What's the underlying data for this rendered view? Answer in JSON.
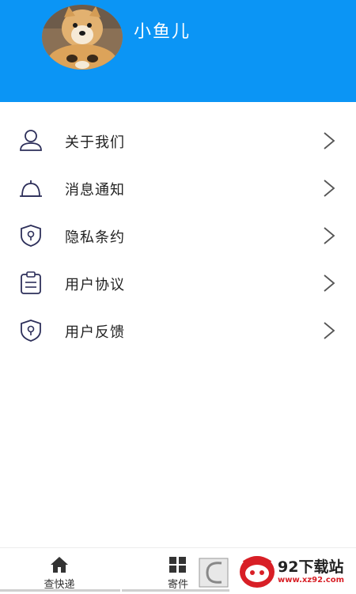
{
  "header": {
    "username": "小鱼儿"
  },
  "menu": {
    "items": [
      {
        "label": "关于我们",
        "icon": "user-icon"
      },
      {
        "label": "消息通知",
        "icon": "bell-icon"
      },
      {
        "label": "隐私条约",
        "icon": "shield-icon"
      },
      {
        "label": "用户协议",
        "icon": "clipboard-icon"
      },
      {
        "label": "用户反馈",
        "icon": "shield-icon"
      }
    ]
  },
  "tabbar": {
    "tabs": [
      {
        "label": "查快递",
        "icon": "home-icon"
      },
      {
        "label": "寄件",
        "icon": "grid-icon"
      }
    ]
  },
  "watermark": {
    "text": "92下载站",
    "url": "www.xz92.com"
  },
  "colors": {
    "header": "#0b95f5",
    "icon": "#2d2f5a",
    "watermark_red": "#d81f26"
  }
}
